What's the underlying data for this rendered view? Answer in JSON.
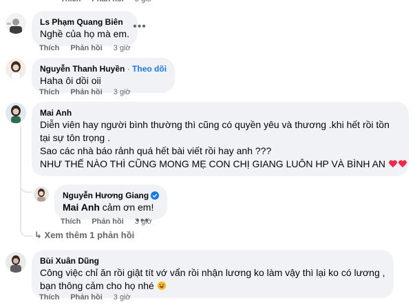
{
  "comments": [
    {
      "author": "Ls Phạm Quang Biên",
      "lines": [
        "Nghề của họ mà em."
      ],
      "like": "Thích",
      "reply": "Phản hồi",
      "time": "3 giờ"
    },
    {
      "author": "Nguyễn Thanh Huyền",
      "follow": "Theo dõi",
      "separator": "·",
      "lines": [
        "Haha ôi dồi oii"
      ],
      "like": "Thích",
      "reply": "Phản hồi",
      "time": "3 giờ"
    },
    {
      "author": "Mai Anh",
      "lines": [
        "Diễn viên hay người bình thường thì cũng có quyền yêu và thương .khi hết rồi tồn",
        "tại sự tôn trọng .",
        "Sao các nhà báo rảnh quá hết bài viết rồi hay anh ???",
        "NHƯ THẾ NÀO THÌ CŨNG MONG MẸ CON CHỊ GIANG LUÔN HP VÀ BÌNH AN"
      ],
      "like": "Thích",
      "reply": "Phản hồi",
      "time": "3 giờ"
    },
    {
      "author": "Nguyễn Hương Giang",
      "mention": "Mai Anh",
      "text": " cảm ơn em!",
      "like": "Thích",
      "reply": "Phản hồi",
      "time": "3 giờ"
    },
    {
      "author": "Bùi Xuân Dũng",
      "lines": [
        "Công việc chỉ ăn rồi giật tít vớ vẩn rồi nhận lương ko làm vậy thì lại ko có lương ,",
        "bạn thông cảm cho họ nhé"
      ],
      "like": "Thích",
      "reply": "Phản hồi",
      "time": "3 giờ"
    }
  ],
  "view_more_replies": "Xem thêm 1 phản hồi",
  "more_icon": "•••",
  "colors": {
    "bubble": "#f0f2f5",
    "link": "#1877f2",
    "muted": "#65676b",
    "heart": "#f02849"
  }
}
